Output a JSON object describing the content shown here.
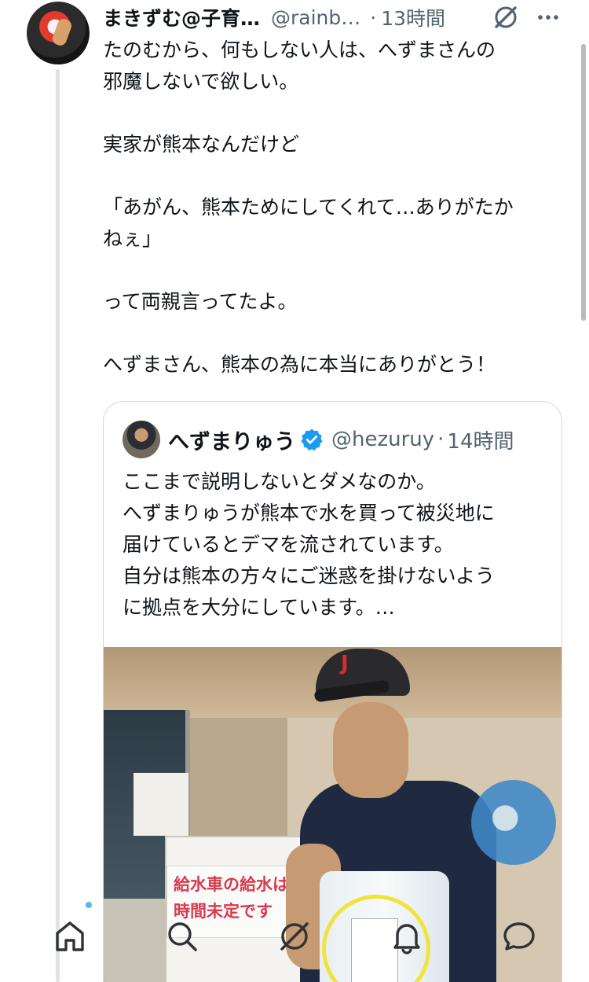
{
  "tweet": {
    "author_name": "まきずむ@子育…",
    "author_handle": "@rainb…",
    "time": "13時間",
    "icons": {
      "grok": "grok-icon",
      "more": "more-icon"
    },
    "text_lines": [
      "たのむから、何もしない人は、へずまさんの",
      "邪魔しないで欲しい。",
      "",
      "実家が熊本なんだけど",
      "",
      "「あがん、熊本ためにしてくれて…ありがたか",
      "ねぇ」",
      "",
      "って両親言ってたよ。",
      "",
      "へずまさん、熊本の為に本当にありがとう！"
    ]
  },
  "quote": {
    "author_name": "へずまりゅう",
    "verified": true,
    "author_handle": "@hezuruy",
    "time": "14時間",
    "text_lines": [
      "ここまで説明しないとダメなのか。",
      "へずまりゅうが熊本で水を買って被災地に",
      "届けているとデマを流されています。",
      "自分は熊本の方々にご迷惑を掛けないよう",
      "に拠点を大分にしています。…"
    ],
    "image": {
      "sign_lines": [
        "給水車の給水は",
        "時間未定です"
      ],
      "cap_letter": "J"
    }
  },
  "tabbar": {
    "items": [
      "home-icon",
      "search-icon",
      "grok-icon",
      "notifications-icon",
      "messages-icon"
    ],
    "accent_color": "#1d9bf0"
  }
}
